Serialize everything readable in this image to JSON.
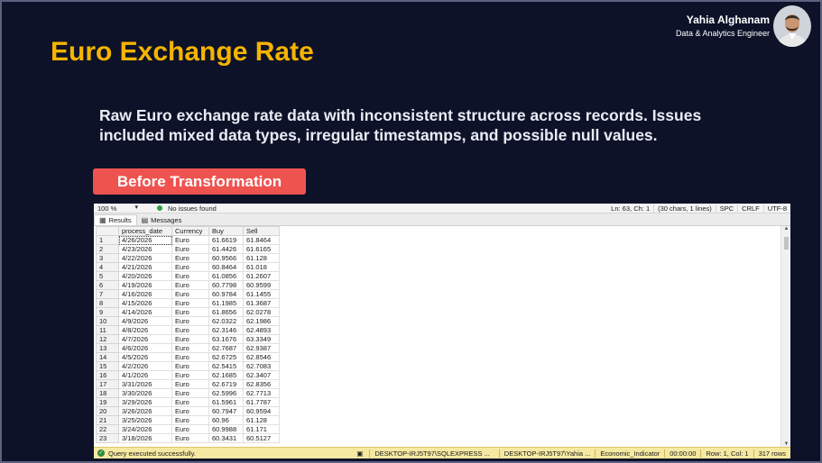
{
  "author": {
    "name": "Yahia Alghanam",
    "role": "Data & Analytics Engineer"
  },
  "slide": {
    "title": "Euro Exchange Rate",
    "description": "Raw Euro exchange rate data with inconsistent structure across records. Issues included mixed data types, irregular timestamps, and possible null values.",
    "badge": "Before Transformation"
  },
  "colors": {
    "background": "#0d1228",
    "title": "#f5b400",
    "badge": "#ef5350",
    "status_bar": "#f5e9a2"
  },
  "ssms": {
    "zoom": "100 %",
    "issues": "No issues found",
    "position": "Ln: 63, Ch: 1",
    "selection": "(30 chars, 1 lines)",
    "whitespace": "SPC",
    "line_ending": "CRLF",
    "encoding": "UTF-8",
    "tabs": [
      {
        "label": "Results",
        "icon": "grid-icon"
      },
      {
        "label": "Messages",
        "icon": "messages-icon"
      }
    ],
    "columns": [
      "process_date",
      "Currency",
      "Buy",
      "Sell"
    ],
    "rows": [
      [
        "1",
        "4/26/2026",
        "Euro",
        "61.6619",
        "61.8464"
      ],
      [
        "2",
        "4/23/2026",
        "Euro",
        "61.4426",
        "61.6165"
      ],
      [
        "3",
        "4/22/2026",
        "Euro",
        "60.9566",
        "61.128"
      ],
      [
        "4",
        "4/21/2026",
        "Euro",
        "60.8464",
        "61.018"
      ],
      [
        "5",
        "4/20/2026",
        "Euro",
        "61.0856",
        "61.2607"
      ],
      [
        "6",
        "4/19/2026",
        "Euro",
        "60.7798",
        "60.9599"
      ],
      [
        "7",
        "4/16/2026",
        "Euro",
        "60.9784",
        "61.1455"
      ],
      [
        "8",
        "4/15/2026",
        "Euro",
        "61.1985",
        "61.3687"
      ],
      [
        "9",
        "4/14/2026",
        "Euro",
        "61.8656",
        "62.0278"
      ],
      [
        "10",
        "4/9/2026",
        "Euro",
        "62.0322",
        "62.1986"
      ],
      [
        "11",
        "4/8/2026",
        "Euro",
        "62.3146",
        "62.4893"
      ],
      [
        "12",
        "4/7/2026",
        "Euro",
        "63.1676",
        "63.3349"
      ],
      [
        "13",
        "4/6/2026",
        "Euro",
        "62.7687",
        "62.9387"
      ],
      [
        "14",
        "4/5/2026",
        "Euro",
        "62.6725",
        "62.8546"
      ],
      [
        "15",
        "4/2/2026",
        "Euro",
        "62.5415",
        "62.7083"
      ],
      [
        "16",
        "4/1/2026",
        "Euro",
        "62.1685",
        "62.3407"
      ],
      [
        "17",
        "3/31/2026",
        "Euro",
        "62.6719",
        "62.8356"
      ],
      [
        "18",
        "3/30/2026",
        "Euro",
        "62.5996",
        "62.7713"
      ],
      [
        "19",
        "3/29/2026",
        "Euro",
        "61.5961",
        "61.7787"
      ],
      [
        "20",
        "3/26/2026",
        "Euro",
        "60.7947",
        "60.9594"
      ],
      [
        "21",
        "3/25/2026",
        "Euro",
        "60.96",
        "61.128"
      ],
      [
        "22",
        "3/24/2026",
        "Euro",
        "60.9988",
        "61.171"
      ],
      [
        "23",
        "3/18/2026",
        "Euro",
        "60.3431",
        "60.5127"
      ]
    ],
    "status": {
      "message": "Query executed successfully.",
      "server": "DESKTOP-IRJ5T97\\SQLEXPRESS ...",
      "user": "DESKTOP-IRJ5T97\\Yahia ...",
      "database": "Economic_Indicator",
      "elapsed": "00:00:00",
      "cursor": "Row: 1, Col: 1",
      "row_count": "317 rows"
    }
  }
}
